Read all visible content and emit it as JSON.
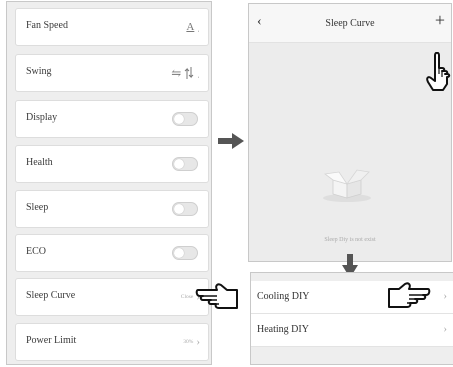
{
  "settings": {
    "rows": [
      {
        "label": "Fan Speed",
        "value": "A",
        "value_suffix": "ˌ"
      },
      {
        "label": "Swing",
        "value": "⇋",
        "value_suffix": "ˌ"
      },
      {
        "label": "Display",
        "toggle_on": false
      },
      {
        "label": "Health",
        "toggle_on": false
      },
      {
        "label": "Sleep",
        "toggle_on": false
      },
      {
        "label": "ECO",
        "toggle_on": false
      },
      {
        "label": "Sleep Curve",
        "value": "Close"
      },
      {
        "label": "Power Limit",
        "value": "30%"
      }
    ],
    "chevron": "›"
  },
  "sleep_curve": {
    "back_label": "‹",
    "title": "Sleep Curve",
    "add_label": "+",
    "empty_message": "Sleep Diy is not exist"
  },
  "diy_menu": {
    "items": [
      {
        "label": "Cooling DIY"
      },
      {
        "label": "Heating DIY"
      }
    ],
    "chevron": "›"
  },
  "colors": {
    "arrow": "#555555",
    "hand_outline": "#111111"
  }
}
